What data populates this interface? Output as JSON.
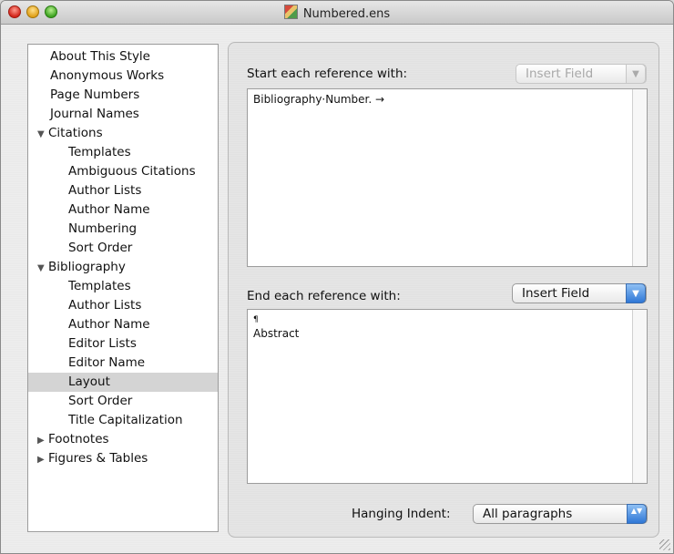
{
  "window": {
    "title": "Numbered.ens"
  },
  "sidebar": {
    "items": [
      {
        "label": "About This Style",
        "level": 0
      },
      {
        "label": "Anonymous Works",
        "level": 0
      },
      {
        "label": "Page Numbers",
        "level": 0
      },
      {
        "label": "Journal Names",
        "level": 0
      },
      {
        "label": "Citations",
        "level": 0,
        "disclosure": "expanded"
      },
      {
        "label": "Templates",
        "level": 1
      },
      {
        "label": "Ambiguous Citations",
        "level": 1
      },
      {
        "label": "Author Lists",
        "level": 1
      },
      {
        "label": "Author Name",
        "level": 1
      },
      {
        "label": "Numbering",
        "level": 1
      },
      {
        "label": "Sort Order",
        "level": 1
      },
      {
        "label": "Bibliography",
        "level": 0,
        "disclosure": "expanded"
      },
      {
        "label": "Templates",
        "level": 1
      },
      {
        "label": "Author Lists",
        "level": 1
      },
      {
        "label": "Author Name",
        "level": 1
      },
      {
        "label": "Editor Lists",
        "level": 1
      },
      {
        "label": "Editor Name",
        "level": 1
      },
      {
        "label": "Layout",
        "level": 1,
        "selected": true
      },
      {
        "label": "Sort Order",
        "level": 1
      },
      {
        "label": "Title Capitalization",
        "level": 1
      },
      {
        "label": "Footnotes",
        "level": 0,
        "disclosure": "collapsed"
      },
      {
        "label": "Figures & Tables",
        "level": 0,
        "disclosure": "collapsed"
      }
    ]
  },
  "layout": {
    "start_label": "Start each reference with:",
    "start_insert_field": "Insert Field",
    "start_content": "Bibliography·Number. →",
    "end_label": "End each reference with:",
    "end_insert_field": "Insert Field",
    "end_pilcrow": "¶",
    "end_content": "Abstract",
    "hanging_indent_label": "Hanging Indent:",
    "hanging_indent_value": "All paragraphs"
  },
  "icons": {
    "disclosure_expanded": "▼",
    "disclosure_collapsed": "▶",
    "popup_arrow": "▼",
    "stepper_arrows": "▲▼"
  },
  "colors": {
    "selection": "#d4d4d4",
    "accent_blue": "#2f77d6"
  }
}
